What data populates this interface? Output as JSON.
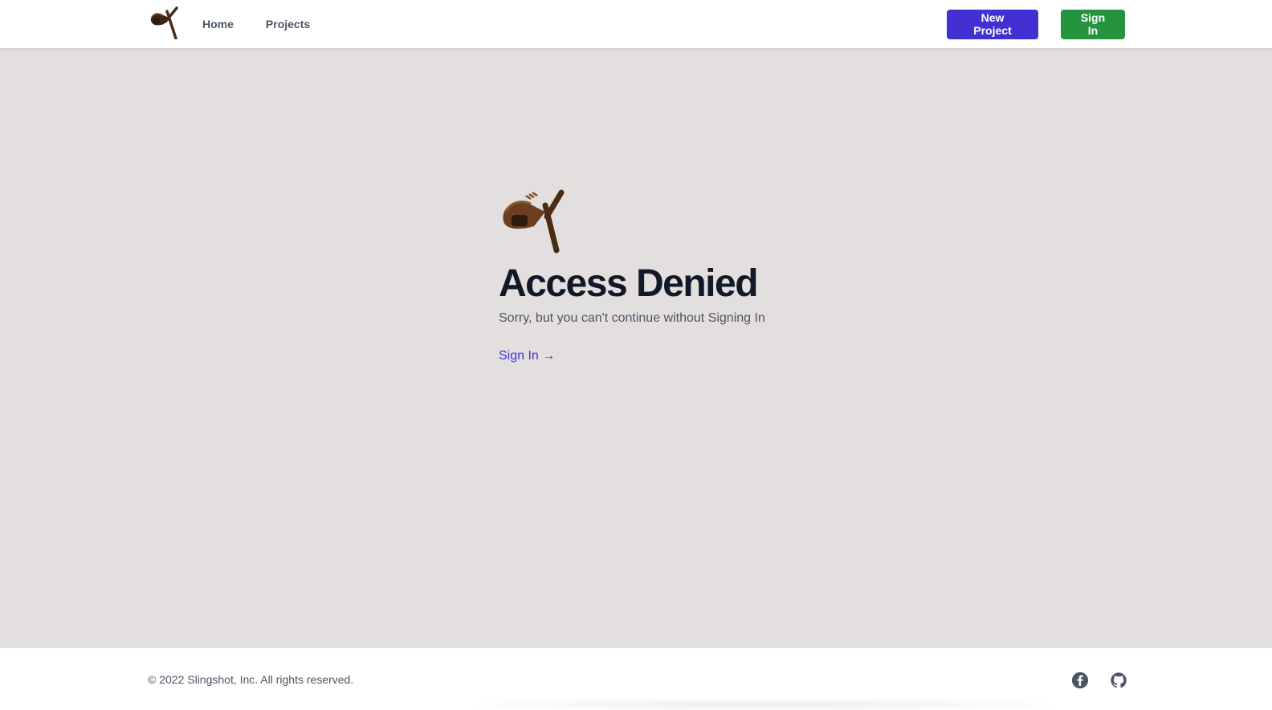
{
  "header": {
    "logo_icon": "slingshot-logo-icon",
    "nav": [
      {
        "label": "Home"
      },
      {
        "label": "Projects"
      }
    ],
    "new_project_label": "New Project",
    "sign_in_label": "Sign In"
  },
  "main": {
    "logo_icon": "slingshot-logo-icon",
    "title": "Access Denied",
    "subtitle": "Sorry, but you can't continue without Signing In",
    "sign_in_link": "Sign In →"
  },
  "footer": {
    "copyright": "© 2022 Slingshot, Inc. All rights reserved.",
    "social": [
      {
        "icon": "facebook-icon"
      },
      {
        "icon": "github-icon"
      }
    ]
  },
  "colors": {
    "background": "#e3dfdf",
    "primary": "#4330d2",
    "success": "#25943f",
    "text_dark": "#111827",
    "text_muted": "#4b5563",
    "logo_brown": "#5c3a1e"
  }
}
